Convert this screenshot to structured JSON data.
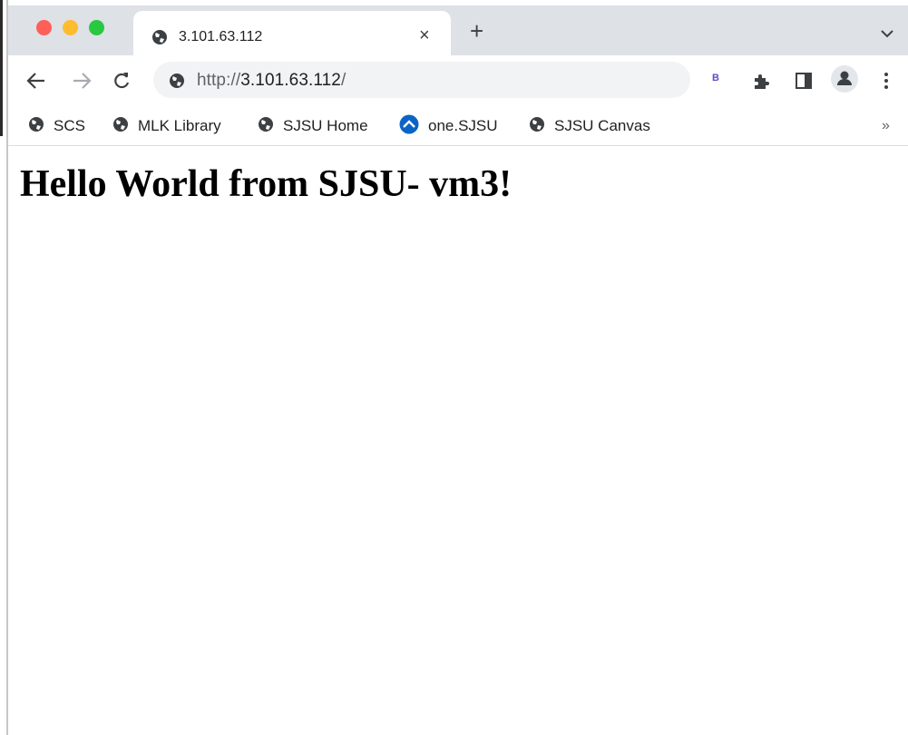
{
  "tab": {
    "title": "3.101.63.112",
    "close_glyph": "×",
    "new_tab_glyph": "+"
  },
  "omnibox": {
    "scheme": "http://",
    "host": "3.101.63.112",
    "path": "/"
  },
  "extensions": {
    "badge_text": "B"
  },
  "bookmarks": [
    {
      "label": "SCS",
      "icon": "globe-icon"
    },
    {
      "label": "MLK Library",
      "icon": "globe-icon"
    },
    {
      "label": "SJSU Home",
      "icon": "globe-icon"
    },
    {
      "label": "one.SJSU",
      "icon": "onesjsu-logo-icon"
    },
    {
      "label": "SJSU Canvas",
      "icon": "globe-icon"
    }
  ],
  "bookmarks_overflow": "»",
  "page": {
    "heading": "Hello World from SJSU- vm3!"
  },
  "colors": {
    "tabstrip": "#dee1e6",
    "omnibox": "#f1f3f4",
    "close": "#fe5f57",
    "minimize": "#febc2e",
    "zoom": "#28c840"
  }
}
